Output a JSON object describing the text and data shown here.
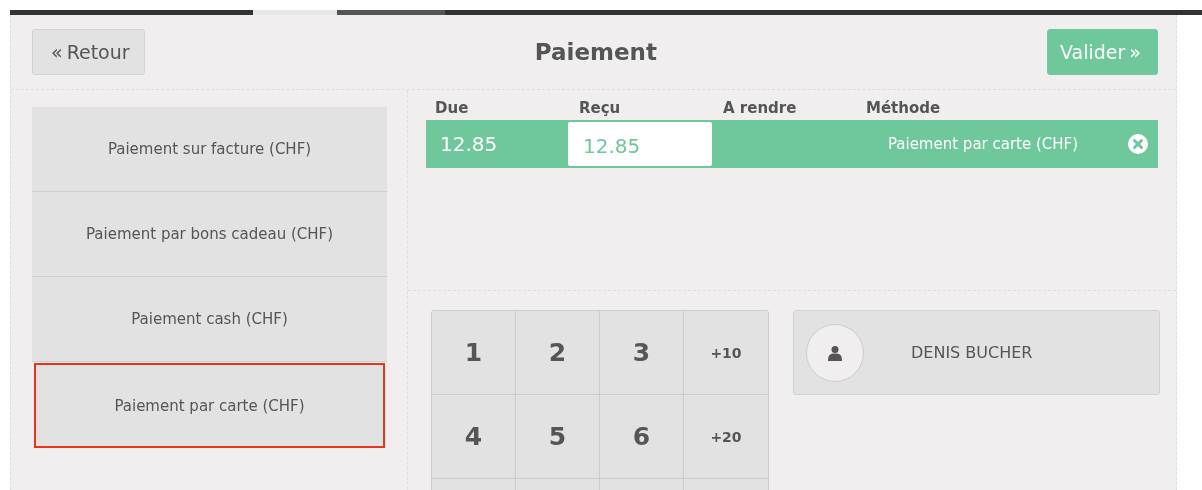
{
  "header": {
    "back_button": {
      "icon": "«",
      "label": "Retour"
    },
    "title": "Paiement",
    "validate_button": {
      "label": "Valider",
      "icon": "»"
    }
  },
  "payment_methods": [
    {
      "label": "Paiement sur facture (CHF)",
      "selected": false
    },
    {
      "label": "Paiement par bons cadeau (CHF)",
      "selected": false
    },
    {
      "label": "Paiement cash (CHF)",
      "selected": false
    },
    {
      "label": "Paiement par carte (CHF)",
      "selected": true
    }
  ],
  "paymentlines": {
    "columns": [
      "Due",
      "Reçu",
      "A rendre",
      "Méthode"
    ],
    "rows": [
      {
        "due": "12.85",
        "received": "12.85",
        "method": "Paiement par carte (CHF)",
        "selected": true
      }
    ]
  },
  "numpad": {
    "keys": [
      {
        "label": "1",
        "kind": "digit"
      },
      {
        "label": "2",
        "kind": "digit"
      },
      {
        "label": "3",
        "kind": "digit"
      },
      {
        "label": "+10",
        "kind": "amount"
      },
      {
        "label": "4",
        "kind": "digit"
      },
      {
        "label": "5",
        "kind": "digit"
      },
      {
        "label": "6",
        "kind": "digit"
      },
      {
        "label": "+20",
        "kind": "amount"
      }
    ]
  },
  "customer": {
    "name": "DENIS BUCHER"
  }
}
